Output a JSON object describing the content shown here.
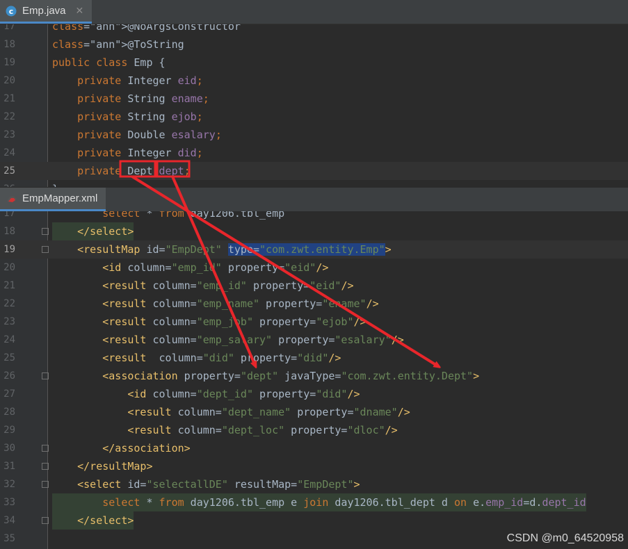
{
  "top_tab": {
    "filename": "Emp.java",
    "icon": "java-class-icon",
    "close": "✕"
  },
  "java_lines": [
    {
      "n": "17",
      "t": "@NoArgsConstructor"
    },
    {
      "n": "18",
      "t": "@ToString"
    },
    {
      "n": "19",
      "t": "public class Emp {"
    },
    {
      "n": "20",
      "t": "    private Integer eid;"
    },
    {
      "n": "21",
      "t": "    private String ename;"
    },
    {
      "n": "22",
      "t": "    private String ejob;"
    },
    {
      "n": "23",
      "t": "    private Double esalary;"
    },
    {
      "n": "24",
      "t": "    private Integer did;"
    },
    {
      "n": "25",
      "t": "    private Dept dept;"
    },
    {
      "n": "26",
      "t": "}"
    }
  ],
  "bottom_tab": {
    "filename": "EmpMapper.xml",
    "icon": "mybatis-icon"
  },
  "xml_lines": [
    {
      "n": "17",
      "t": "        select * from day1206.tbl_emp"
    },
    {
      "n": "18",
      "t": "    </select>"
    },
    {
      "n": "19",
      "t": "    <resultMap id=\"EmpDept\" type=\"com.zwt.entity.Emp\">"
    },
    {
      "n": "20",
      "t": "        <id column=\"emp_id\" property=\"eid\"/>"
    },
    {
      "n": "21",
      "t": "        <result column=\"emp_id\" property=\"eid\"/>"
    },
    {
      "n": "22",
      "t": "        <result column=\"emp_name\" property=\"ename\"/>"
    },
    {
      "n": "23",
      "t": "        <result column=\"emp_job\" property=\"ejob\"/>"
    },
    {
      "n": "24",
      "t": "        <result column=\"emp_salary\" property=\"esalary\"/>"
    },
    {
      "n": "25",
      "t": "        <result  column=\"did\" property=\"did\"/>"
    },
    {
      "n": "26",
      "t": "        <association property=\"dept\" javaType=\"com.zwt.entity.Dept\">"
    },
    {
      "n": "27",
      "t": "            <id column=\"dept_id\" property=\"did\"/>"
    },
    {
      "n": "28",
      "t": "            <result column=\"dept_name\" property=\"dname\"/>"
    },
    {
      "n": "29",
      "t": "            <result column=\"dept_loc\" property=\"dloc\"/>"
    },
    {
      "n": "30",
      "t": "        </association>"
    },
    {
      "n": "31",
      "t": "    </resultMap>"
    },
    {
      "n": "32",
      "t": "    <select id=\"selectallDE\" resultMap=\"EmpDept\">"
    },
    {
      "n": "33",
      "t": "        select * from day1206.tbl_emp e join day1206.tbl_dept d on e.emp_id=d.dept_id"
    },
    {
      "n": "34",
      "t": "    </select>"
    },
    {
      "n": "35",
      "t": ""
    }
  ],
  "watermark": "CSDN @m0_64520958",
  "colors": {
    "keyword": "#cc7832",
    "annotation": "#bbb529",
    "field": "#9876aa",
    "tag": "#e8bf6a",
    "string": "#6a8759",
    "arrow": "#e8262b"
  }
}
